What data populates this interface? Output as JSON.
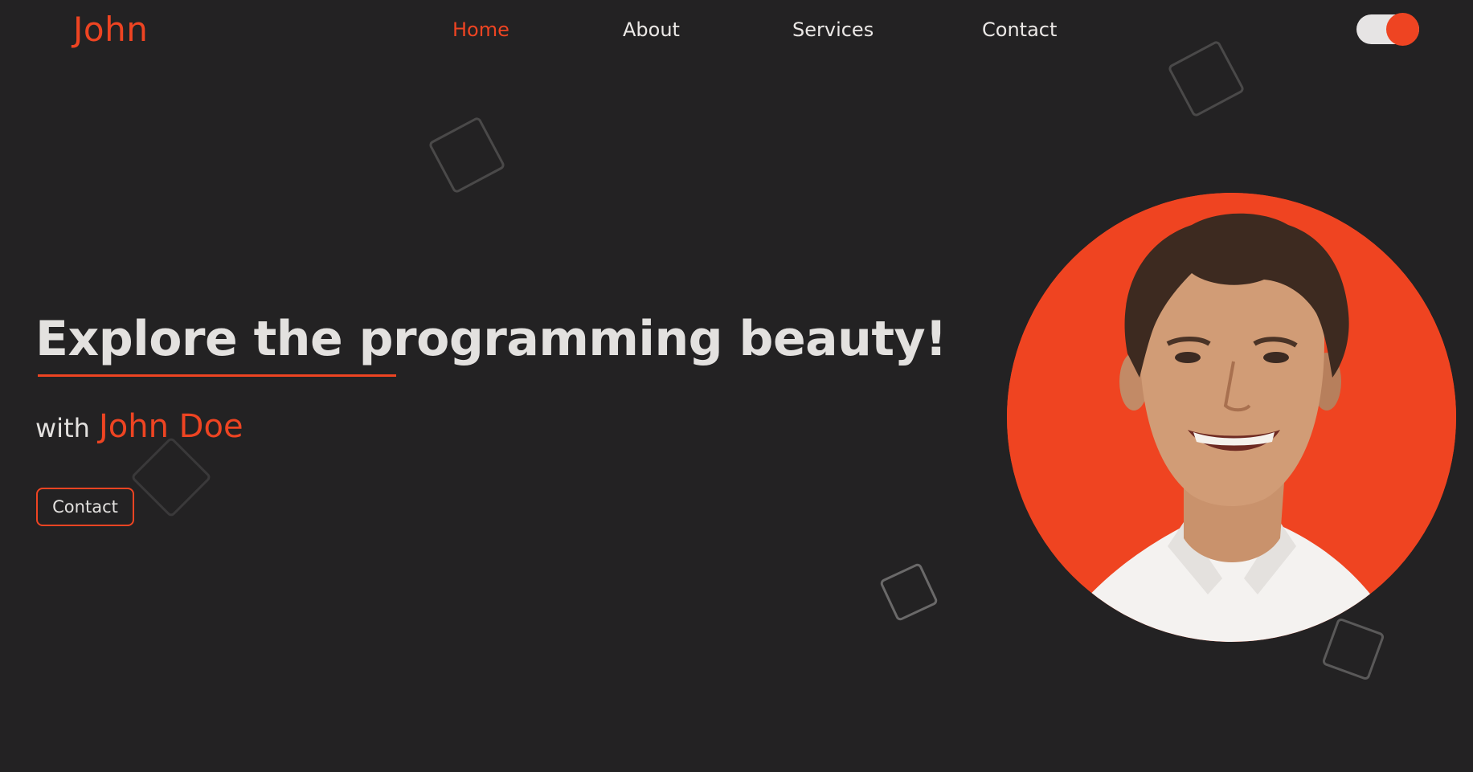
{
  "brand": {
    "name": "John"
  },
  "nav": {
    "items": [
      {
        "label": "Home",
        "active": true
      },
      {
        "label": "About",
        "active": false
      },
      {
        "label": "Services",
        "active": false
      },
      {
        "label": "Contact",
        "active": false
      }
    ]
  },
  "theme_toggle": {
    "state": "on"
  },
  "hero": {
    "title": "Explore the programming beauty!",
    "subtitle_prefix": "with",
    "name": "John Doe",
    "cta_label": "Contact"
  },
  "colors": {
    "accent": "#ee4422",
    "background": "#232223",
    "text": "#e3e1df"
  },
  "icons": {
    "decorative": "outlined-rotated-square"
  }
}
